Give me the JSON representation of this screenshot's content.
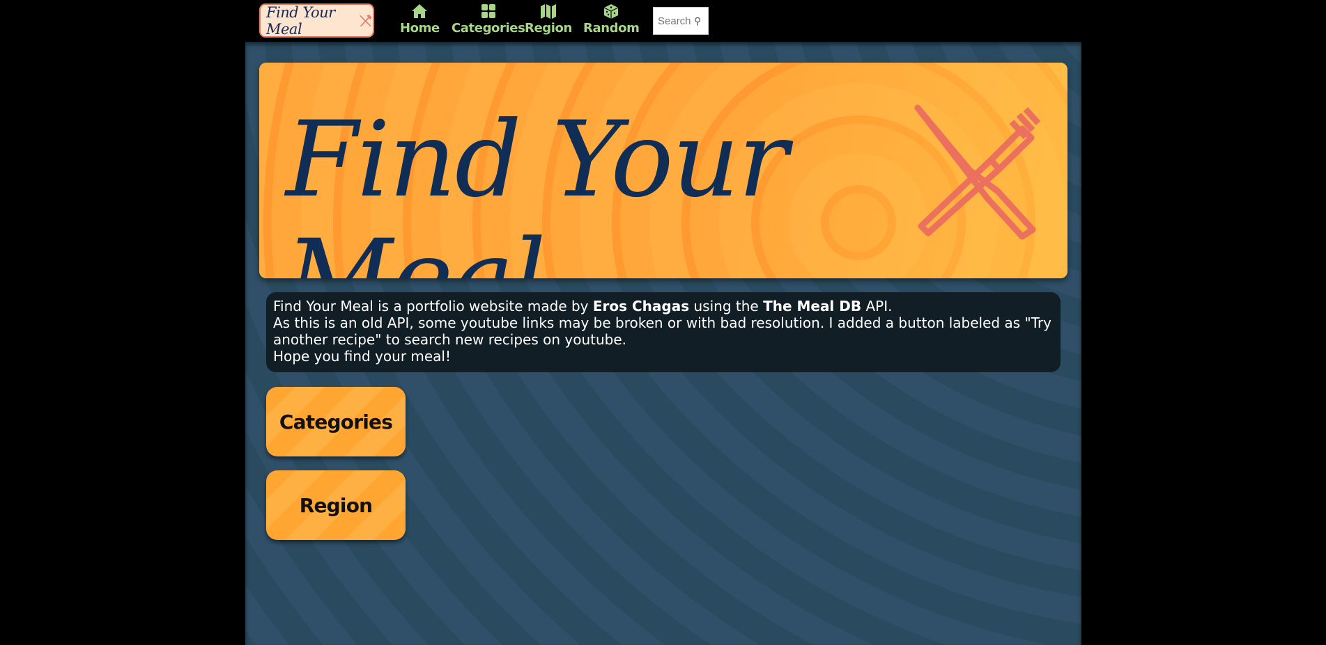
{
  "header": {
    "logo_text": "Find Your Meal",
    "logo_icon": "fork-knife-icon",
    "nav": [
      {
        "label": "Home",
        "icon": "house-icon"
      },
      {
        "label": "Categories",
        "icon": "grid-icon"
      },
      {
        "label": "Region",
        "icon": "map-icon"
      },
      {
        "label": "Random",
        "icon": "dice-icon"
      }
    ],
    "search_placeholder": "Search",
    "nav_color": "#a7d68a"
  },
  "banner": {
    "title": "Find Your Meal",
    "icon": "fork-knife-icon",
    "title_color": "#0f2d55",
    "icon_color": "#eb705e"
  },
  "info": {
    "line1_prefix": "Find Your Meal is a portfolio website made by ",
    "author": "Eros Chagas",
    "line1_middle": " using the ",
    "api_name": "The Meal DB",
    "line1_suffix": " API.",
    "line2": "As this is an old API, some youtube links may be broken or with bad resolution. I added a button labeled as \"Try another recipe\" to search new recipes on youtube.",
    "line3": "Hope you find your meal!"
  },
  "cards": [
    {
      "label": "Categories"
    },
    {
      "label": "Region"
    }
  ]
}
